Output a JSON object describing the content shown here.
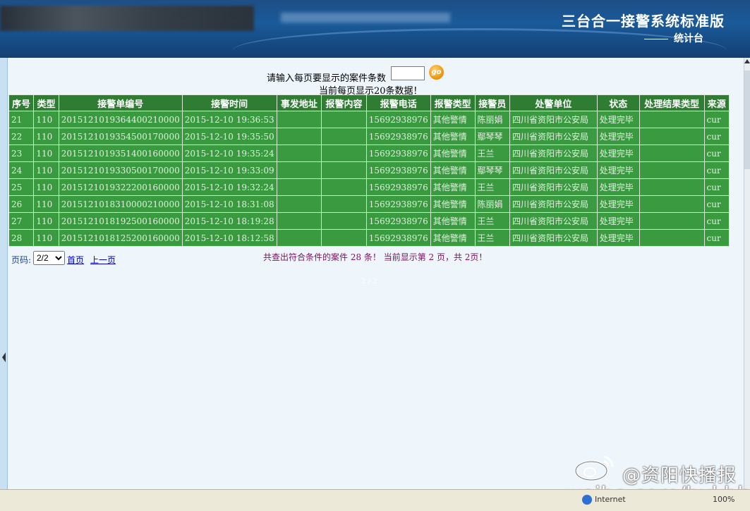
{
  "header": {
    "system_title": "三台合一接警系统标准版",
    "subtitle": "统计台"
  },
  "controls": {
    "prompt": "请输入每页要显示的案件条数",
    "input_value": "",
    "go_label": "go",
    "current_info": "当前每页显示20条数据！"
  },
  "table": {
    "columns": [
      "序号",
      "类型",
      "接警单编号",
      "接警时间",
      "事发地址",
      "报警内容",
      "报警电话",
      "报警类型",
      "接警员",
      "处警单位",
      "状态",
      "处理结果类型",
      "来源"
    ],
    "rows": [
      [
        "21",
        "110",
        "2015121019364400210000",
        "2015-12-10 19:36:53",
        "",
        "",
        "15692938976",
        "其他警情",
        "陈丽娟",
        "四川省资阳市公安局",
        "处理完毕",
        "",
        "cur"
      ],
      [
        "22",
        "110",
        "2015121019354500170000",
        "2015-12-10 19:35:50",
        "",
        "",
        "15692938976",
        "其他警情",
        "鄢琴琴",
        "四川省资阳市公安局",
        "处理完毕",
        "",
        "cur"
      ],
      [
        "23",
        "110",
        "2015121019351400160000",
        "2015-12-10 19:35:24",
        "",
        "",
        "15692938976",
        "其他警情",
        "王兰",
        "四川省资阳市公安局",
        "处理完毕",
        "",
        "cur"
      ],
      [
        "24",
        "110",
        "2015121019330500170000",
        "2015-12-10 19:33:09",
        "",
        "",
        "15692938976",
        "其他警情",
        "鄢琴琴",
        "四川省资阳市公安局",
        "处理完毕",
        "",
        "cur"
      ],
      [
        "25",
        "110",
        "2015121019322200160000",
        "2015-12-10 19:32:24",
        "",
        "",
        "15692938976",
        "其他警情",
        "王兰",
        "四川省资阳市公安局",
        "处理完毕",
        "",
        "cur"
      ],
      [
        "26",
        "110",
        "2015121018310000210000",
        "2015-12-10 18:31:08",
        "",
        "",
        "15692938976",
        "其他警情",
        "陈丽娟",
        "四川省资阳市公安局",
        "处理完毕",
        "",
        "cur"
      ],
      [
        "27",
        "110",
        "2015121018192500160000",
        "2015-12-10 18:19:28",
        "",
        "",
        "15692938976",
        "其他警情",
        "王兰",
        "四川省资阳市公安局",
        "处理完毕",
        "",
        "cur"
      ],
      [
        "28",
        "110",
        "2015121018125200160000",
        "2015-12-10 18:12:58",
        "",
        "",
        "15692938976",
        "其他警情",
        "王兰",
        "四川省资阳市公安局",
        "处理完毕",
        "",
        "cur"
      ]
    ]
  },
  "pager": {
    "label": "页码:",
    "selected_page": "2/2",
    "first_label": "首页",
    "prev_label": "上一页",
    "summary": "共查出符合条件的案件  28 条！   当前显示第  2 页，共  2页！",
    "faint_text": "2 / 2"
  },
  "watermark": {
    "handle": "@资阳快播报",
    "url": "weibo.com/hxkbb"
  },
  "statusbar": {
    "zone": "Internet",
    "zoom": "100%"
  },
  "colors": {
    "header_bg": "#1a5a99",
    "table_header": "#2e7d32",
    "table_row": "#3a9a3f",
    "page_bg": "#eef6fc",
    "summary_text": "#7a1060",
    "link": "#0000c8"
  }
}
